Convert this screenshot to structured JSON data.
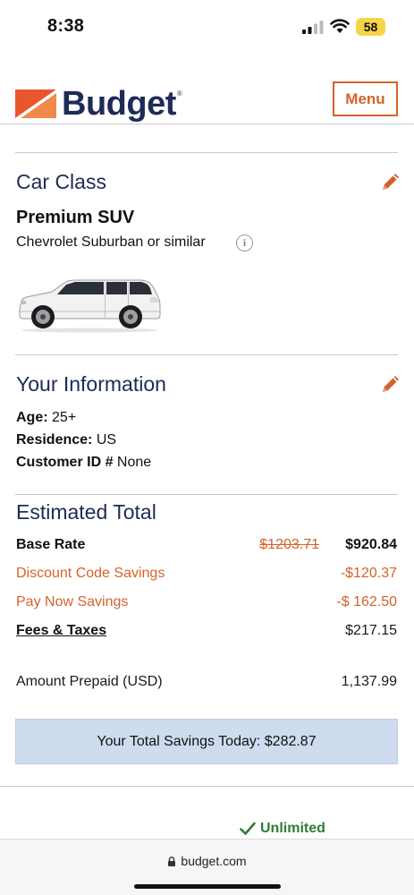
{
  "status_bar": {
    "time": "8:38",
    "battery": "58",
    "icons": [
      "signal-icon",
      "wifi-icon",
      "battery-icon"
    ]
  },
  "header": {
    "logo_text": "Budget",
    "logo_reg": "®",
    "menu_label": "Menu"
  },
  "car_class": {
    "title": "Car Class",
    "name": "Premium SUV",
    "model": "Chevrolet Suburban or similar",
    "info_glyph": "i"
  },
  "your_information": {
    "title": "Your Information",
    "age_label": "Age:",
    "age_value": "25+",
    "residence_label": "Residence:",
    "residence_value": "US",
    "customer_id_label": "Customer ID #",
    "customer_id_value": "None"
  },
  "estimated_total": {
    "title": "Estimated Total",
    "base_rate_label": "Base Rate",
    "base_rate_original": "$1203.71",
    "base_rate_value": "$920.84",
    "discount_label": "Discount Code Savings",
    "discount_value": "-$120.37",
    "pay_now_label": "Pay Now Savings",
    "pay_now_value": "-$ 162.50",
    "fees_label": "Fees & Taxes",
    "fees_value": "$217.15",
    "prepaid_label": "Amount Prepaid (USD)",
    "prepaid_value": "1,137.99",
    "savings_text": "Your Total Savings Today: $282.87"
  },
  "features": {
    "unlimited": "Unlimited"
  },
  "browser": {
    "url": "budget.com"
  },
  "colors": {
    "brand_navy": "#1e2b56",
    "brand_orange": "#d4622a",
    "savings_bg": "#cfdcef",
    "check_green": "#2e7d32"
  }
}
